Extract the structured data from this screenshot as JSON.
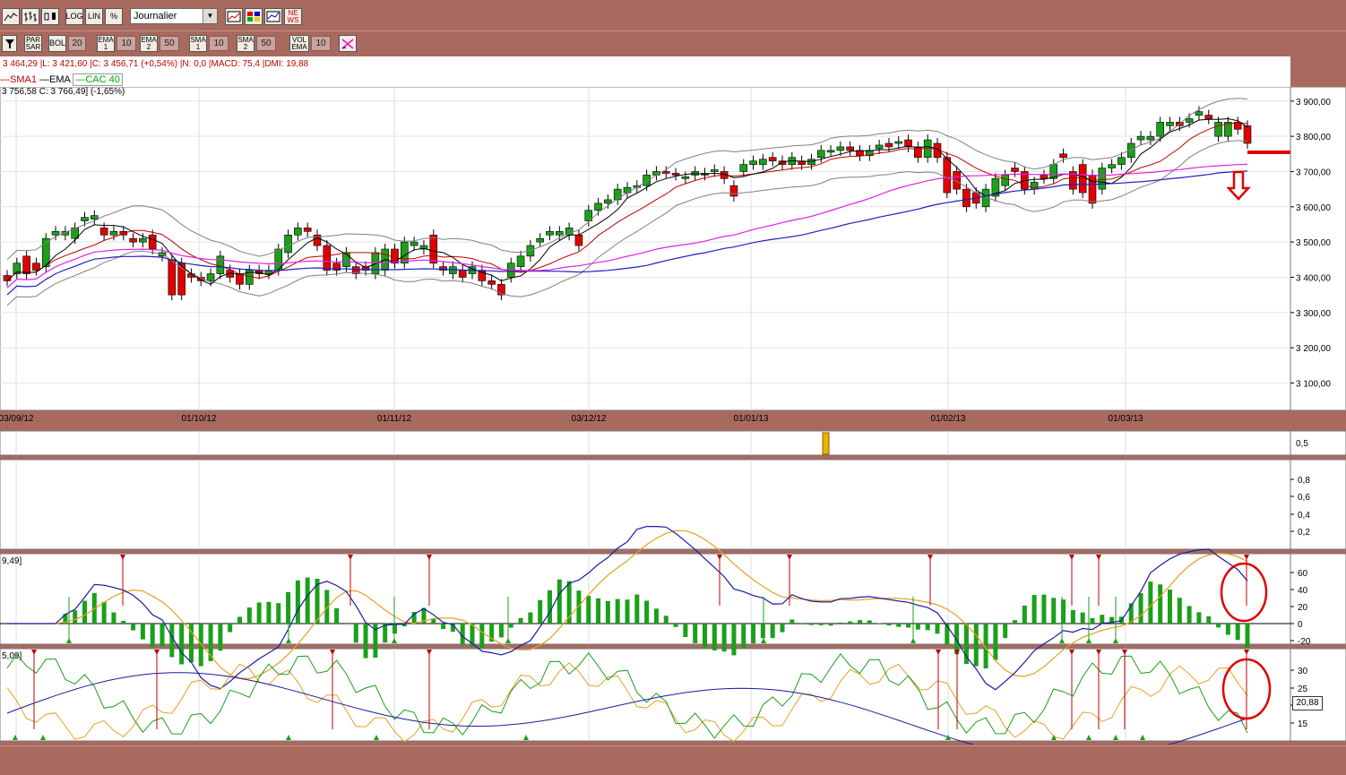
{
  "toolbar1": {
    "period_select": "Journalier",
    "buttons": [
      "LOG",
      "LIN",
      "%"
    ],
    "news_label": [
      "NE",
      "WS"
    ]
  },
  "toolbar2": {
    "par_sar": [
      "PAR",
      "SAR"
    ],
    "bol": "BOL",
    "bol_val": "20",
    "ema1": [
      "EMA",
      "1"
    ],
    "ema1_val": "10",
    "ema2": [
      "EMA",
      "2"
    ],
    "ema2_val": "50",
    "sma1": [
      "SMA",
      "1"
    ],
    "sma1_val": "10",
    "sma2": [
      "SMA",
      "2"
    ],
    "sma2_val": "50",
    "vol_ema": [
      "VOL",
      "EMA"
    ],
    "vol_val": "10"
  },
  "info_line": "3 464,29 |L: 3 421,60 |C: 3 456,71 (+0,54%) |N: 0,0 |MACD: 75,4 |DMI: 19,88",
  "legend": {
    "sma1": "SMA1",
    "ema": "EMA",
    "cac": "CAC 40"
  },
  "ohlc_text": "3 756,58  C: 3 766,49] (-1,65%)",
  "macd_label": "9,49]",
  "dmi_label": "5,09]",
  "rsi_readout": "20,88",
  "colors": {
    "up": "#1aa01a",
    "down": "#e00000",
    "bb": "#808080",
    "ema": "#2020c0",
    "sma": "#e020e0",
    "macd": "#1a1aa0",
    "signal": "#e8a020",
    "hist": "#1aa01a",
    "marker": "#c00000"
  },
  "chart_data": {
    "type": "candlestick",
    "price_axis": {
      "ticks": [
        "3 900,00",
        "3 800,00",
        "3 700,00",
        "3 600,00",
        "3 500,00",
        "3 400,00",
        "3 300,00",
        "3 200,00",
        "3 100,00"
      ],
      "range": [
        3030,
        3930
      ]
    },
    "date_ticks": [
      "03/09/12",
      "01/10/12",
      "01/11/12",
      "03/12/12",
      "01/01/13",
      "01/02/13",
      "01/03/13"
    ],
    "candles": [
      [
        3405,
        3390
      ],
      [
        3410,
        3440
      ],
      [
        3460,
        3410
      ],
      [
        3440,
        3420
      ],
      [
        3430,
        3510
      ],
      [
        3520,
        3530
      ],
      [
        3520,
        3530
      ],
      [
        3510,
        3540
      ],
      [
        3560,
        3570
      ],
      [
        3565,
        3575
      ],
      [
        3540,
        3520
      ],
      [
        3520,
        3530
      ],
      [
        3530,
        3520
      ],
      [
        3510,
        3500
      ],
      [
        3500,
        3510
      ],
      [
        3520,
        3480
      ],
      [
        3460,
        3470
      ],
      [
        3450,
        3350
      ],
      [
        3440,
        3350
      ],
      [
        3410,
        3400
      ],
      [
        3400,
        3390
      ],
      [
        3390,
        3410
      ],
      [
        3410,
        3460
      ],
      [
        3420,
        3400
      ],
      [
        3410,
        3380
      ],
      [
        3380,
        3420
      ],
      [
        3420,
        3410
      ],
      [
        3410,
        3420
      ],
      [
        3420,
        3480
      ],
      [
        3470,
        3520
      ],
      [
        3520,
        3540
      ],
      [
        3540,
        3530
      ],
      [
        3520,
        3490
      ],
      [
        3490,
        3420
      ],
      [
        3440,
        3420
      ],
      [
        3430,
        3470
      ],
      [
        3430,
        3410
      ],
      [
        3430,
        3420
      ],
      [
        3410,
        3470
      ],
      [
        3420,
        3480
      ],
      [
        3480,
        3440
      ],
      [
        3440,
        3500
      ],
      [
        3490,
        3500
      ],
      [
        3480,
        3490
      ],
      [
        3520,
        3440
      ],
      [
        3430,
        3420
      ],
      [
        3410,
        3430
      ],
      [
        3420,
        3400
      ],
      [
        3410,
        3430
      ],
      [
        3420,
        3390
      ],
      [
        3390,
        3380
      ],
      [
        3380,
        3350
      ],
      [
        3400,
        3440
      ],
      [
        3430,
        3460
      ],
      [
        3460,
        3490
      ],
      [
        3500,
        3510
      ],
      [
        3520,
        3530
      ],
      [
        3520,
        3530
      ],
      [
        3520,
        3540
      ],
      [
        3520,
        3490
      ],
      [
        3560,
        3590
      ],
      [
        3590,
        3610
      ],
      [
        3610,
        3620
      ],
      [
        3620,
        3650
      ],
      [
        3640,
        3655
      ],
      [
        3655,
        3660
      ],
      [
        3660,
        3690
      ],
      [
        3690,
        3700
      ],
      [
        3700,
        3695
      ],
      [
        3695,
        3690
      ],
      [
        3680,
        3685
      ],
      [
        3690,
        3700
      ],
      [
        3690,
        3695
      ],
      [
        3700,
        3705
      ],
      [
        3700,
        3680
      ],
      [
        3660,
        3630
      ],
      [
        3700,
        3720
      ],
      [
        3720,
        3730
      ],
      [
        3720,
        3735
      ],
      [
        3740,
        3730
      ],
      [
        3730,
        3720
      ],
      [
        3720,
        3740
      ],
      [
        3730,
        3720
      ],
      [
        3720,
        3735
      ],
      [
        3740,
        3760
      ],
      [
        3760,
        3760
      ],
      [
        3760,
        3770
      ],
      [
        3770,
        3760
      ],
      [
        3760,
        3745
      ],
      [
        3745,
        3760
      ],
      [
        3765,
        3775
      ],
      [
        3780,
        3770
      ],
      [
        3780,
        3785
      ],
      [
        3790,
        3770
      ],
      [
        3770,
        3740
      ],
      [
        3740,
        3790
      ],
      [
        3780,
        3740
      ],
      [
        3740,
        3640
      ],
      [
        3700,
        3650
      ],
      [
        3650,
        3600
      ],
      [
        3640,
        3610
      ],
      [
        3600,
        3650
      ],
      [
        3630,
        3680
      ],
      [
        3660,
        3690
      ],
      [
        3710,
        3700
      ],
      [
        3700,
        3650
      ],
      [
        3650,
        3670
      ],
      [
        3690,
        3680
      ],
      [
        3680,
        3720
      ],
      [
        3750,
        3740
      ],
      [
        3700,
        3650
      ],
      [
        3720,
        3640
      ],
      [
        3690,
        3610
      ],
      [
        3650,
        3710
      ],
      [
        3710,
        3720
      ],
      [
        3720,
        3740
      ],
      [
        3740,
        3780
      ],
      [
        3790,
        3800
      ],
      [
        3790,
        3800
      ],
      [
        3800,
        3840
      ],
      [
        3830,
        3840
      ],
      [
        3840,
        3830
      ],
      [
        3840,
        3850
      ],
      [
        3860,
        3870
      ],
      [
        3860,
        3850
      ],
      [
        3800,
        3840
      ],
      [
        3800,
        3840
      ],
      [
        3840,
        3820
      ],
      [
        3830,
        3780
      ]
    ],
    "macd_ticks": [
      "60",
      "40",
      "20",
      "0",
      "-20"
    ],
    "dmi_ticks": [
      "30",
      "25",
      "20",
      "15"
    ],
    "vol_ticks": [
      "0,8",
      "0,6",
      "0,4",
      "0,2"
    ],
    "vol_tick_top": "0,5"
  }
}
